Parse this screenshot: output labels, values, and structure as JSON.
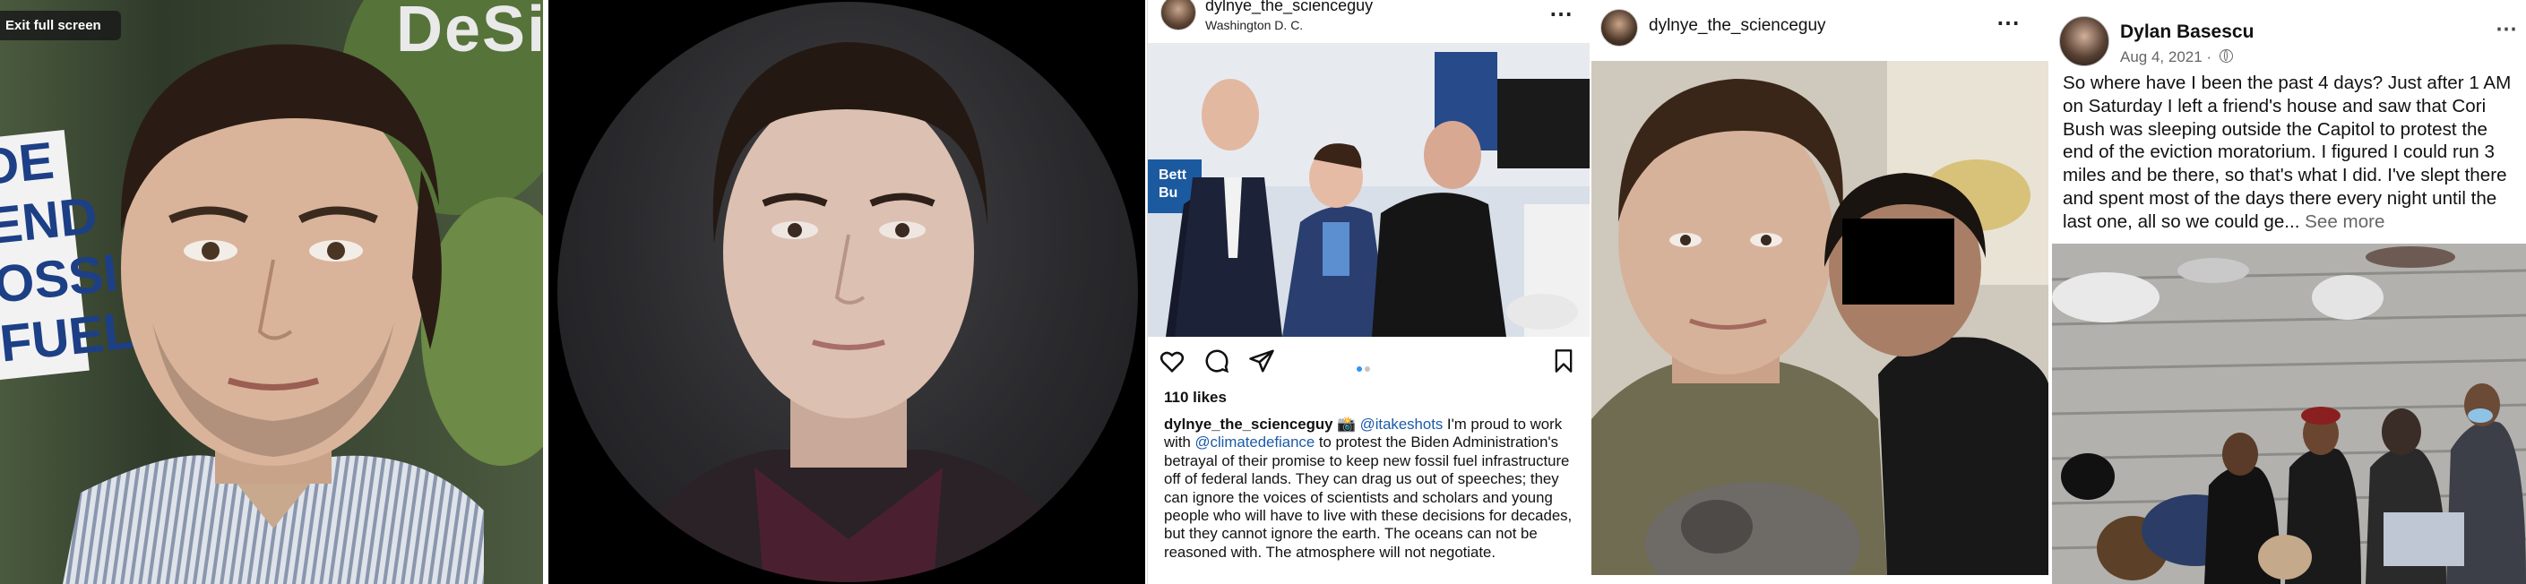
{
  "panel1": {
    "exit_label": "Exit full screen",
    "sign_right_text": "DeSi",
    "sign_left_lines": [
      "DE",
      "END",
      "OSSI",
      "FUEL"
    ]
  },
  "instagram_post": {
    "username": "dylnye_the_scienceguy",
    "location": "Washington D. C.",
    "more_icon": "⋯",
    "likes": "110 likes",
    "caption_user": "dylnye_the_scienceguy",
    "caption_emoji": "📸",
    "mention1": "@itakeshots",
    "caption_part1": " I'm proud to work with ",
    "mention2": "@climatedefiance",
    "caption_part2": " to protest the Biden Administration's betrayal of their promise to keep new fossil fuel infrastructure off of federal lands. They can drag us out of speeches; they can ignore the voices of scientists and scholars and young people who will have to live with these decisions for decades, but they cannot ignore the earth. The oceans can not be reasoned with. The atmosphere will not negotiate.",
    "photo_banner_text": "Bett",
    "photo_banner_text2": "Bu",
    "icons": [
      "heart-icon",
      "comment-icon",
      "share-icon",
      "bookmark-icon"
    ]
  },
  "instagram_selfie": {
    "username": "dylnye_the_scienceguy",
    "more_icon": "⋯"
  },
  "facebook_post": {
    "name": "Dylan Basescu",
    "date": "Aug 4, 2021 · ",
    "more_icon": "⋯",
    "text": "So where have I been the past 4 days? Just after 1 AM on Saturday I left a friend's house and saw that Cori Bush was sleeping outside the Capitol to protest the end of the eviction moratorium. I figured I could run 3 miles and be there, so that's what I did. I've slept there and spent most of the days there every night until the last one, all so we could ge...",
    "see_more": " See more"
  },
  "colors": {
    "instagram_link": "#1c5aa8",
    "carousel_active": "#2f95f0",
    "redaction": "#000000"
  }
}
